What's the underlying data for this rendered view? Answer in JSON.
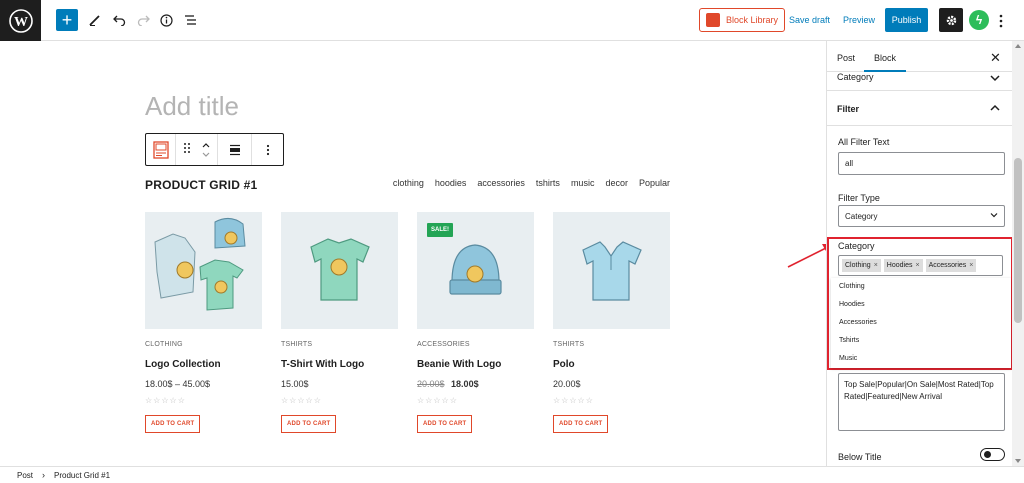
{
  "toolbar": {
    "block_library_label": "Block Library",
    "save_draft_label": "Save draft",
    "preview_label": "Preview",
    "publish_label": "Publish"
  },
  "editor": {
    "title_placeholder": "Add title",
    "grid_title": "PRODUCT GRID #1",
    "filters": [
      "clothing",
      "hoodies",
      "accessories",
      "tshirts",
      "music",
      "decor",
      "Popular"
    ],
    "add_to_cart_label": "ADD TO CART",
    "products": [
      {
        "category": "CLOTHING",
        "name": "Logo Collection",
        "price": "18.00$ – 45.00$",
        "old_price": "",
        "sale": false
      },
      {
        "category": "TSHIRTS",
        "name": "T-Shirt With Logo",
        "price": "15.00$",
        "old_price": "",
        "sale": false
      },
      {
        "category": "ACCESSORIES",
        "name": "Beanie With Logo",
        "price": "18.00$",
        "old_price": "20.00$",
        "sale": true,
        "sale_label": "SALE!"
      },
      {
        "category": "TSHIRTS",
        "name": "Polo",
        "price": "20.00$",
        "old_price": "",
        "sale": false
      }
    ],
    "stars": "☆☆☆☆☆"
  },
  "sidebar": {
    "tabs": [
      "Post",
      "Block"
    ],
    "category_collapsed_label": "Category",
    "filter_label": "Filter",
    "all_filter_text_label": "All Filter Text",
    "all_filter_text_value": "all",
    "filter_type_label": "Filter Type",
    "filter_type_value": "Category",
    "category_label": "Category",
    "selected_categories": [
      "Clothing",
      "Hoodies",
      "Accessories"
    ],
    "category_suggestions": [
      "Clothing",
      "Hoodies",
      "Accessories",
      "Tshirts",
      "Music"
    ],
    "actions_text": "Top Sale|Popular|On Sale|Most Rated|Top Rated|Featured|New Arrival",
    "below_title_label": "Below Title"
  },
  "breadcrumb": [
    "Post",
    "Product Grid #1"
  ],
  "colors": {
    "accent": "#007cba",
    "brand_red": "#e0482a",
    "highlight_red": "#e0232f",
    "sale_green": "#23a455"
  }
}
